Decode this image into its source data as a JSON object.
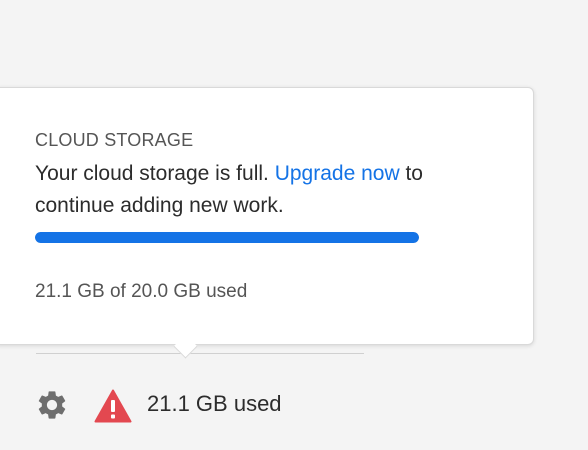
{
  "popover": {
    "heading": "CLOUD STORAGE",
    "message_before": "Your cloud storage is full. ",
    "upgrade_link": "Upgrade now",
    "message_after": " to continue adding new work.",
    "progress_fraction": 1.0,
    "usage_text": "21.1 GB of 20.0 GB used"
  },
  "status_bar": {
    "settings_icon": "gear-icon",
    "warning_icon": "warning-triangle-icon",
    "used_text": "21.1 GB used"
  },
  "colors": {
    "accent": "#1473e6",
    "warning": "#e34850",
    "text": "#2c2c2c",
    "muted": "#555555"
  }
}
